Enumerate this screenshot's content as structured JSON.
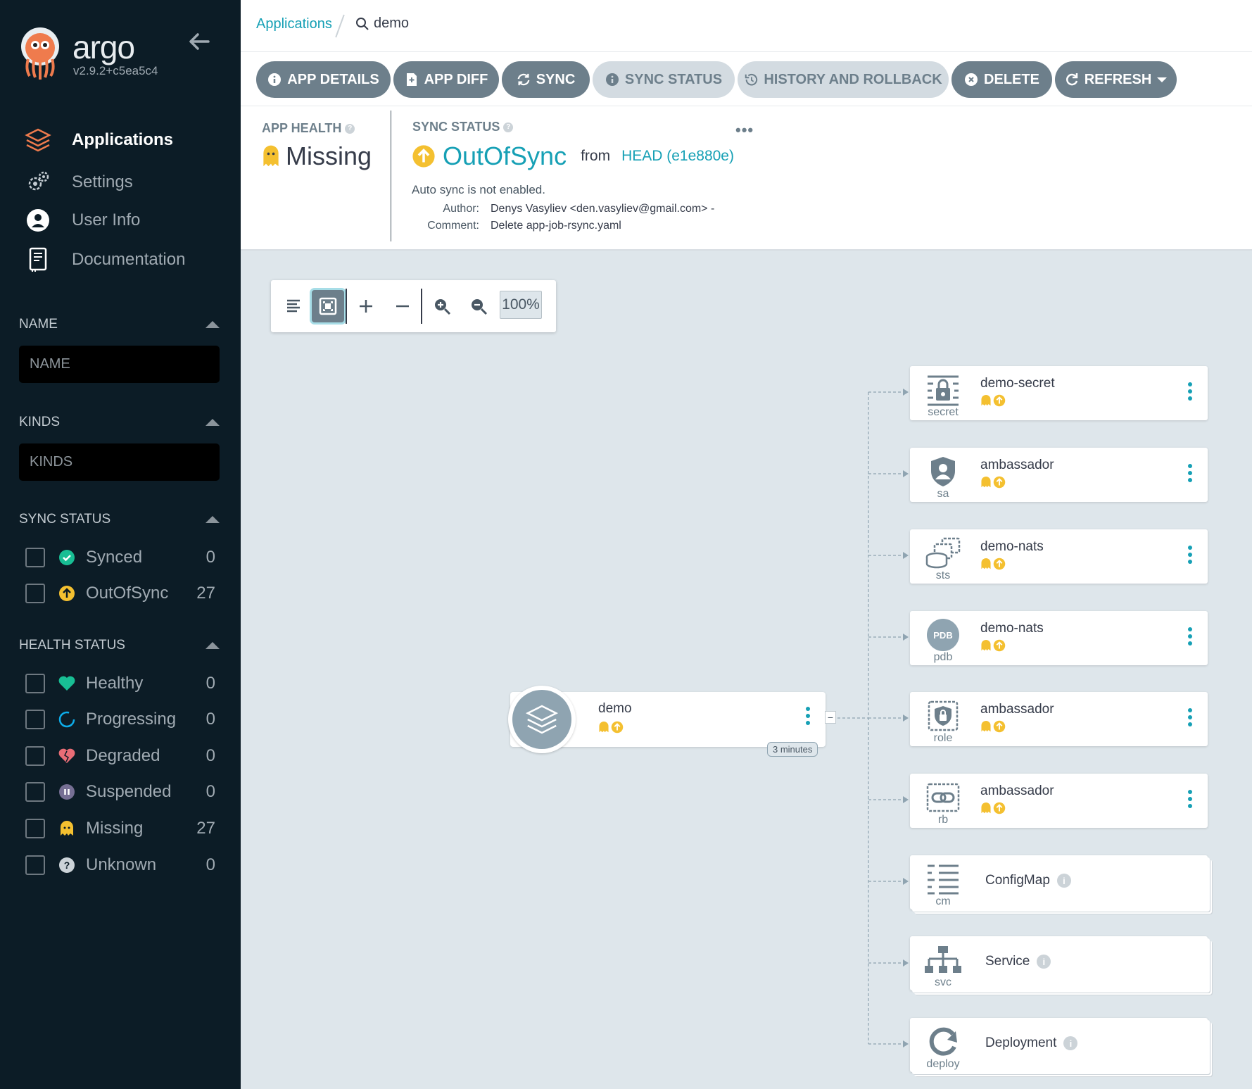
{
  "app": {
    "brand": "argo",
    "version": "v2.9.2+c5ea5c4"
  },
  "nav": [
    {
      "label": "Applications",
      "active": true
    },
    {
      "label": "Settings"
    },
    {
      "label": "User Info"
    },
    {
      "label": "Documentation"
    }
  ],
  "filters": {
    "name": {
      "title": "NAME",
      "placeholder": "NAME"
    },
    "kinds": {
      "title": "KINDS",
      "placeholder": "KINDS"
    },
    "sync_status": {
      "title": "SYNC STATUS",
      "items": [
        {
          "label": "Synced",
          "count": "0"
        },
        {
          "label": "OutOfSync",
          "count": "27"
        }
      ]
    },
    "health_status": {
      "title": "HEALTH STATUS",
      "items": [
        {
          "label": "Healthy",
          "count": "0"
        },
        {
          "label": "Progressing",
          "count": "0"
        },
        {
          "label": "Degraded",
          "count": "0"
        },
        {
          "label": "Suspended",
          "count": "0"
        },
        {
          "label": "Missing",
          "count": "27"
        },
        {
          "label": "Unknown",
          "count": "0"
        }
      ]
    }
  },
  "breadcrumb": {
    "root": "Applications",
    "current": "demo"
  },
  "toolbar": {
    "app_details": "APP DETAILS",
    "app_diff": "APP DIFF",
    "sync": "SYNC",
    "sync_status": "SYNC STATUS",
    "history": "HISTORY AND ROLLBACK",
    "delete": "DELETE",
    "refresh": "REFRESH"
  },
  "status": {
    "health_title": "APP HEALTH",
    "health_value": "Missing",
    "sync_title": "SYNC STATUS",
    "sync_value": "OutOfSync",
    "from": "from",
    "revision": "HEAD (e1e880e)",
    "auto_sync": "Auto sync is not enabled.",
    "author_label": "Author:",
    "author": "Denys Vasyliev <den.vasyliev@gmail.com> -",
    "comment_label": "Comment:",
    "comment": "Delete app-job-rsync.yaml"
  },
  "graph": {
    "zoom": "100%",
    "root": {
      "name": "demo",
      "age": "3 minutes"
    },
    "nodes": [
      {
        "name": "demo-secret",
        "kind": "secret"
      },
      {
        "name": "ambassador",
        "kind": "sa"
      },
      {
        "name": "demo-nats",
        "kind": "sts"
      },
      {
        "name": "demo-nats",
        "kind": "pdb"
      },
      {
        "name": "ambassador",
        "kind": "role"
      },
      {
        "name": "ambassador",
        "kind": "rb"
      }
    ],
    "groups": [
      {
        "name": "ConfigMap",
        "kind": "cm"
      },
      {
        "name": "Service",
        "kind": "svc"
      },
      {
        "name": "Deployment",
        "kind": "deploy"
      }
    ],
    "pdb_badge": "PDB"
  },
  "colors": {
    "sidebar": "#0c1c26",
    "accent": "#16a0b5",
    "missing": "#f4c030",
    "healthy": "#18be94",
    "degraded": "#e96d76"
  }
}
